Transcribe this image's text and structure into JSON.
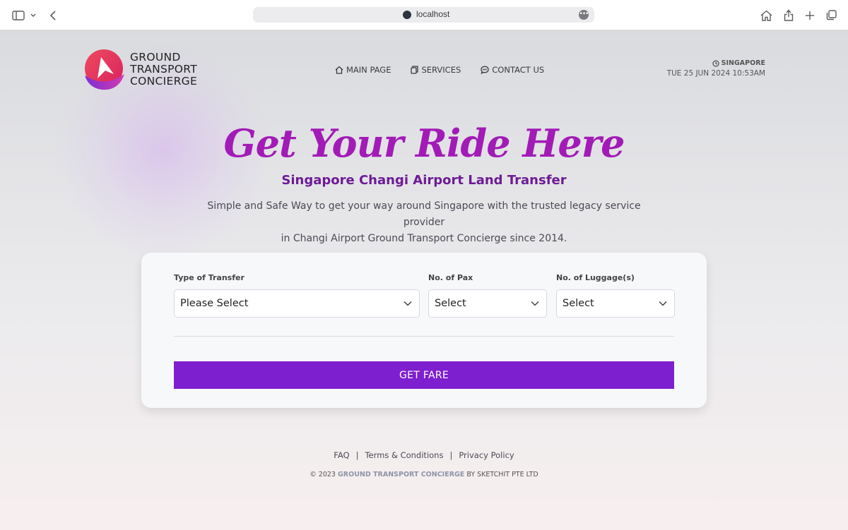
{
  "browser": {
    "url": "localhost"
  },
  "header": {
    "logo_lines": [
      "GROUND",
      "TRANSPORT",
      "CONCIERGE"
    ],
    "nav": [
      {
        "label": "MAIN PAGE",
        "icon": "home-icon"
      },
      {
        "label": "SERVICES",
        "icon": "services-icon"
      },
      {
        "label": "CONTACT US",
        "icon": "chat-icon"
      }
    ],
    "location": "SINGAPORE",
    "datetime": "TUE 25 JUN 2024 10:53AM"
  },
  "hero": {
    "title": "Get Your Ride Here",
    "subtitle": "Singapore Changi Airport Land Transfer",
    "description_line1": "Simple and Safe Way to get your way around Singapore with the trusted legacy service provider",
    "description_line2": "in Changi Airport Ground Transport Concierge since 2014."
  },
  "form": {
    "transfer_label": "Type of Transfer",
    "transfer_value": "Please Select",
    "pax_label": "No. of Pax",
    "pax_value": "Select",
    "luggage_label": "No. of Luggage(s)",
    "luggage_value": "Select",
    "submit_label": "GET FARE"
  },
  "footer": {
    "links": [
      "FAQ",
      "Terms & Conditions",
      "Privacy Policy"
    ],
    "separator": "|",
    "copy_prefix": "© 2023",
    "copy_brand": "GROUND TRANSPORT CONCIERGE",
    "copy_suffix": "BY SKETCHIT PTE LTD"
  },
  "colors": {
    "accent": "#7e1fcf",
    "title": "#a21bb6",
    "subtitle": "#6d1b95",
    "logo_primary": "#e8385f",
    "logo_secondary": "#8a2fd0"
  }
}
